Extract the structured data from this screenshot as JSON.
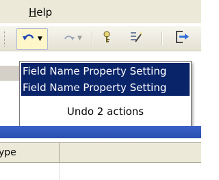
{
  "menu": {
    "help_label_prefix": "H",
    "help_label_rest": "elp"
  },
  "toolbar": {
    "undo_icon": "undo-icon",
    "redo_icon": "redo-icon",
    "primary_key_icon": "key-icon",
    "builder_icon": "wand-icon",
    "insert_rows_icon": "insert-rows-icon"
  },
  "undo_dropdown": {
    "items": [
      "Field Name Property Setting",
      "Field Name Property Setting"
    ],
    "status": "Undo 2 actions"
  },
  "grid": {
    "column_fragment": "ype"
  },
  "colors": {
    "highlight": "#0a246a",
    "chrome": "#ece9d8",
    "band": "#2a4fb0"
  }
}
